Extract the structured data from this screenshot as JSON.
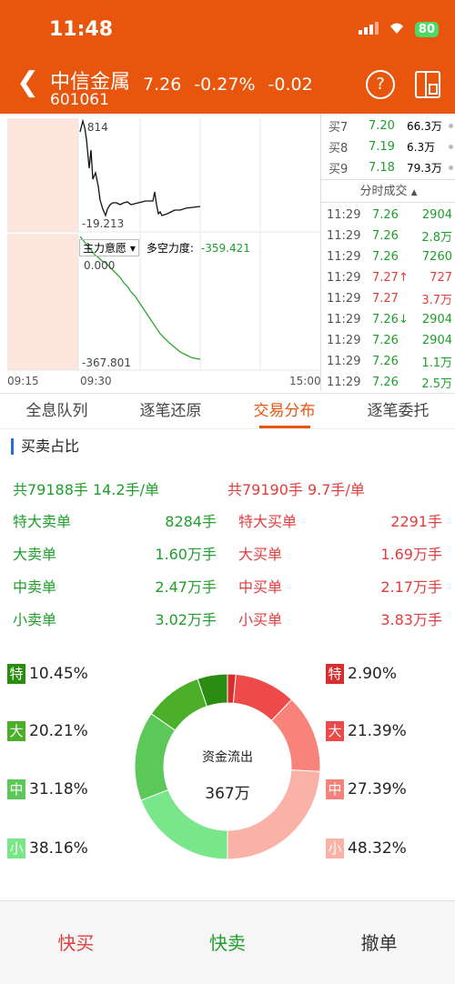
{
  "status": {
    "time": "11:48",
    "battery": "80"
  },
  "stock": {
    "name": "中信金属",
    "code": "601061",
    "price": "7.26",
    "change_pct": "-0.27%",
    "change": "-0.02"
  },
  "chart_labels": {
    "top_high": ".814",
    "top_low": "-19.213",
    "mf_selector": "主力意愿",
    "mf_label": "多空力度:",
    "mf_value": "-359.421",
    "bot_high": "0.000",
    "bot_low": "-367.801",
    "t_start": "09:15",
    "t_mid": "09:30",
    "t_end": "15:00"
  },
  "orderbook": [
    {
      "label": "买7",
      "price": "7.20",
      "vol": "66.3万"
    },
    {
      "label": "买8",
      "price": "7.19",
      "vol": "6.3万"
    },
    {
      "label": "买9",
      "price": "7.18",
      "vol": "79.3万"
    }
  ],
  "timesales_title": "分时成交",
  "trades": [
    {
      "time": "11:29",
      "price": "7.26",
      "vol": "2904",
      "color": "green"
    },
    {
      "time": "11:29",
      "price": "7.26",
      "vol": "2.8万",
      "color": "green"
    },
    {
      "time": "11:29",
      "price": "7.26",
      "vol": "7260",
      "color": "green"
    },
    {
      "time": "11:29",
      "price": "7.27↑",
      "vol": "727",
      "color": "red"
    },
    {
      "time": "11:29",
      "price": "7.27",
      "vol": "3.7万",
      "color": "red"
    },
    {
      "time": "11:29",
      "price": "7.26↓",
      "vol": "2904",
      "color": "green"
    },
    {
      "time": "11:29",
      "price": "7.26",
      "vol": "2904",
      "color": "green"
    },
    {
      "time": "11:29",
      "price": "7.26",
      "vol": "1.1万",
      "color": "green"
    },
    {
      "time": "11:29",
      "price": "7.26",
      "vol": "2.5万",
      "color": "green"
    }
  ],
  "tabs": [
    "全息队列",
    "逐笔还原",
    "交易分布",
    "逐笔委托"
  ],
  "section_title": "买卖占比",
  "sell_total": "共79188手 14.2手/单",
  "buy_total": "共79190手 9.7手/单",
  "sell_rows": [
    {
      "label": "特大卖单",
      "value": "8284手"
    },
    {
      "label": "大卖单",
      "value": "1.60万手"
    },
    {
      "label": "中卖单",
      "value": "2.47万手"
    },
    {
      "label": "小卖单",
      "value": "3.02万手"
    }
  ],
  "buy_rows": [
    {
      "label": "特大买单",
      "value": "2291手"
    },
    {
      "label": "大买单",
      "value": "1.69万手"
    },
    {
      "label": "中买单",
      "value": "2.17万手"
    },
    {
      "label": "小买单",
      "value": "3.83万手"
    }
  ],
  "sell_pct": [
    {
      "tag": "特",
      "value": "10.45%",
      "color": "#2a8c10"
    },
    {
      "tag": "大",
      "value": "20.21%",
      "color": "#4caf2a"
    },
    {
      "tag": "中",
      "value": "31.18%",
      "color": "#5dc85a"
    },
    {
      "tag": "小",
      "value": "38.16%",
      "color": "#7ae68a"
    }
  ],
  "buy_pct": [
    {
      "tag": "特",
      "value": "2.90%",
      "color": "#d62e2e"
    },
    {
      "tag": "大",
      "value": "21.39%",
      "color": "#ee4a4a"
    },
    {
      "tag": "中",
      "value": "27.39%",
      "color": "#f7837a"
    },
    {
      "tag": "小",
      "value": "48.32%",
      "color": "#fbb2a6"
    }
  ],
  "donut": {
    "label": "资金流出",
    "value": "367万"
  },
  "bottom": {
    "buy": "快买",
    "sell": "快卖",
    "cancel": "撤单"
  }
}
